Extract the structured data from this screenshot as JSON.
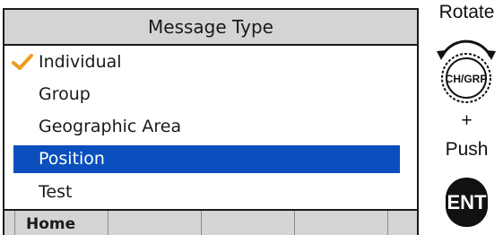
{
  "screen": {
    "title": "Message Type",
    "items": [
      {
        "label": "Individual",
        "checked": true,
        "selected": false
      },
      {
        "label": "Group",
        "checked": false,
        "selected": false
      },
      {
        "label": "Geographic Area",
        "checked": false,
        "selected": false
      },
      {
        "label": "Position",
        "checked": false,
        "selected": true
      },
      {
        "label": "Test",
        "checked": false,
        "selected": false
      }
    ],
    "softkeys": [
      "",
      "Home",
      "",
      "",
      "",
      ""
    ]
  },
  "controls": {
    "rotate_label": "Rotate",
    "knob_label": "CH/GRP",
    "plus": "+",
    "push_label": "Push",
    "ent_label": "ENT"
  },
  "colors": {
    "selection": "#0a4fbd",
    "check": "#f29a1f",
    "title_bar": "#d4d4d4"
  },
  "icons": {
    "checkmark": "checkmark-icon",
    "rotate_arrows": "rotate-arrows-icon"
  }
}
